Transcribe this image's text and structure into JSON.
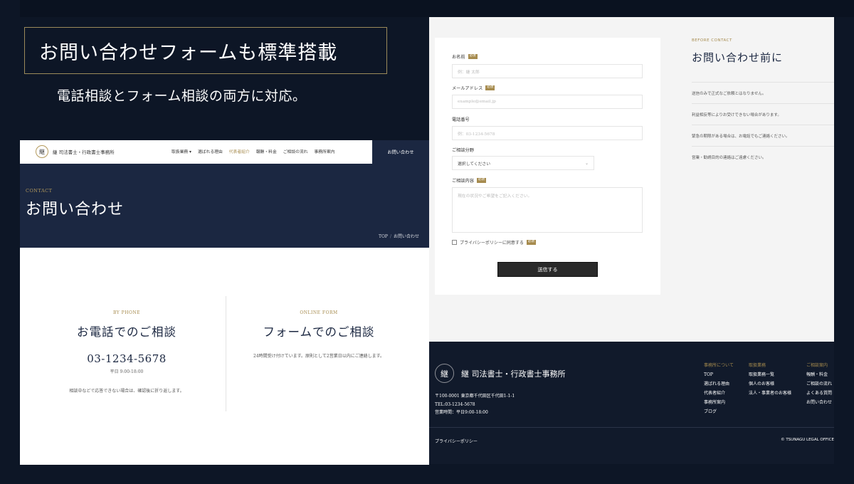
{
  "promo": {
    "headline": "お問い合わせフォームも標準搭載",
    "subline": "電話相談とフォーム相談の両方に対応。"
  },
  "left_screen": {
    "nav": {
      "logo_glyph": "継",
      "office_name": "継 司法書士・行政書士事務所",
      "links": [
        "取扱業務 ▾",
        "選ばれる理由",
        "代表者紹介",
        "報酬・料金",
        "ご相談の流れ",
        "事務所案内"
      ],
      "cta": "お問い合わせ"
    },
    "hero": {
      "eyebrow": "CONTACT",
      "title": "お問い合わせ",
      "breadcrumb": [
        "TOP",
        "お問い合わせ"
      ]
    },
    "phone": {
      "eyebrow": "BY PHONE",
      "title": "お電話でのご相談",
      "number": "03-1234-5678",
      "hours": "平日 9:00-18:00",
      "note": "相談中などで応答できない場合は、確認後に折り返します。"
    },
    "online": {
      "eyebrow": "ONLINE FORM",
      "title": "フォームでのご相談",
      "note": "24時間受け付けています。原則として2営業日以内にご連絡します。"
    }
  },
  "right_screen": {
    "form": {
      "name_label": "お名前",
      "name_placeholder": "例：継 太郎",
      "email_label": "メールアドレス",
      "email_placeholder": "example@email.jp",
      "phone_label": "電話番号",
      "phone_placeholder": "例：03-1234-5678",
      "category_label": "ご相談分野",
      "category_value": "選択してください",
      "message_label": "ご相談内容",
      "message_placeholder": "現在の状況やご希望をご記入ください。",
      "required_badge": "必須",
      "privacy_label": "プライバシーポリシーに同意する",
      "submit_label": "送信する"
    },
    "before_contact": {
      "eyebrow": "BEFORE CONTACT",
      "title": "お問い合わせ前に",
      "items": [
        "送信のみで正式なご依頼とはなりません。",
        "利益相反等によりお受けできない場合があります。",
        "緊急の期限がある場合は、お電話でもご連絡ください。",
        "営業・勧誘目的の連絡はご遠慮ください。"
      ]
    },
    "footer": {
      "logo_glyph": "継",
      "office_name": "継 司法書士・行政書士事務所",
      "address_lines": [
        "〒100-0001 東京都千代田区千代田1-1-1",
        "TEL:03-1234-5678",
        "営業時間：平日9:00-18:00"
      ],
      "columns": [
        {
          "head": "事務所について",
          "items": [
            "TOP",
            "選ばれる理由",
            "代表者紹介",
            "事務所案内",
            "ブログ"
          ]
        },
        {
          "head": "取扱業務",
          "items": [
            "取扱業務一覧",
            "個人のお客様",
            "法人・事業者のお客様"
          ]
        },
        {
          "head": "ご相談案内",
          "items": [
            "報酬・料金",
            "ご相談の流れ",
            "よくある質問",
            "お問い合わせ"
          ]
        }
      ],
      "privacy": "プライバシーポリシー",
      "copyright": "© TSUNAGU LEGAL OFFICE"
    }
  },
  "colors": {
    "background": "#0d1626",
    "navy": "#1b2741",
    "gold": "#a68b4e"
  }
}
